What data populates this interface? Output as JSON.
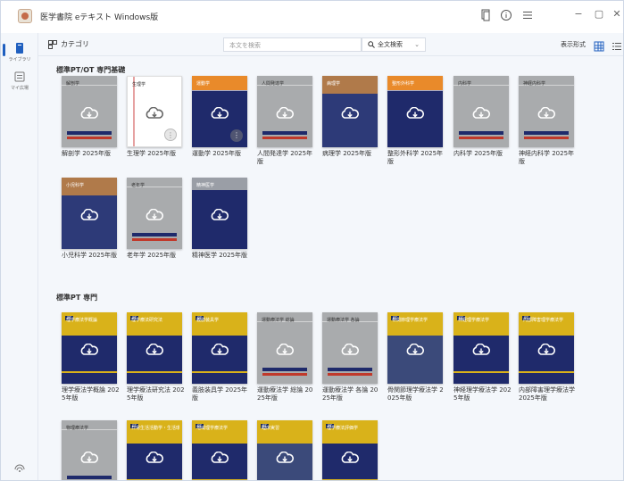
{
  "app": {
    "title": "医学書院 eテキスト Windows版"
  },
  "title_bar": {
    "icons": [
      "copy-icon",
      "info-icon",
      "menu-icon"
    ],
    "window_controls": {
      "minimize": "−",
      "maximize": "▢",
      "close": "✕"
    }
  },
  "rail": {
    "library_label": "ライブラリ",
    "mypage_label": "マイ広場"
  },
  "toolbar": {
    "category_label": "カテゴリ",
    "search_placeholder": "本文を検索",
    "search_mode": "全文検索",
    "view_label": "表示形式"
  },
  "sections": [
    {
      "title": "標準PT/OT 専門基礎",
      "books": [
        {
          "title": "解剖学 2025年版",
          "cover_title": "解剖学",
          "style": "gray"
        },
        {
          "title": "生理学 2025年版",
          "cover_title": "生理学",
          "style": "white"
        },
        {
          "title": "運動学 2025年版",
          "cover_title": "運動学",
          "style": "orange-navy"
        },
        {
          "title": "人間発達学 2025年版",
          "cover_title": "人間発達学",
          "style": "gray"
        },
        {
          "title": "病理学 2025年版",
          "cover_title": "病理学",
          "style": "brown-navy"
        },
        {
          "title": "整形外科学 2025年版",
          "cover_title": "整形外科学",
          "style": "orange-navy"
        },
        {
          "title": "内科学 2025年版",
          "cover_title": "内科学",
          "style": "gray"
        },
        {
          "title": "神経内科学 2025年版",
          "cover_title": "神経内科学",
          "style": "gray"
        },
        {
          "title": "小児科学 2025年版",
          "cover_title": "小児科学",
          "style": "brown-navy"
        },
        {
          "title": "老年学 2025年版",
          "cover_title": "老年学",
          "style": "gray"
        },
        {
          "title": "精神医学 2025年版",
          "cover_title": "精神医学",
          "style": "gray-navy"
        }
      ]
    },
    {
      "title": "標準PT 専門",
      "books": [
        {
          "title": "理学療法学概論 2025年版",
          "cover_title": "理学療法学概論",
          "style": "yellow-navy"
        },
        {
          "title": "理学療法研究法 2025年版",
          "cover_title": "理学療法研究法",
          "style": "yellow-navy"
        },
        {
          "title": "義肢装具学 2025年版",
          "cover_title": "義肢装具学",
          "style": "yellow-navy"
        },
        {
          "title": "運動療法学 総論 2025年版",
          "cover_title": "運動療法学 総論",
          "style": "gray"
        },
        {
          "title": "運動療法学 各論 2025年版",
          "cover_title": "運動療法学 各論",
          "style": "gray"
        },
        {
          "title": "骨関節理学療法学 2025年版",
          "cover_title": "骨関節理学療法学",
          "style": "yellow-slate"
        },
        {
          "title": "神経理学療法学 2025年版",
          "cover_title": "神経理学療法学",
          "style": "yellow-navy"
        },
        {
          "title": "内部障害理学療法学 2025年版",
          "cover_title": "内部障害理学療法学",
          "style": "yellow-navy"
        },
        {
          "title": "",
          "cover_title": "物理療法学",
          "style": "gray"
        },
        {
          "title": "",
          "cover_title": "日常生活活動学・生活環境学",
          "style": "yellow-navy"
        },
        {
          "title": "",
          "cover_title": "地域理学療法学",
          "style": "yellow-navy"
        },
        {
          "title": "",
          "cover_title": "臨床実習",
          "style": "yellow-slate"
        },
        {
          "title": "",
          "cover_title": "理学療法評価学",
          "style": "yellow-navy"
        }
      ]
    }
  ],
  "colors": {
    "navy": "#1f2a6b",
    "orange": "#e98a2a",
    "yellow": "#d9b21a",
    "gray": "#a9abad",
    "accent": "#1f5fbf"
  }
}
